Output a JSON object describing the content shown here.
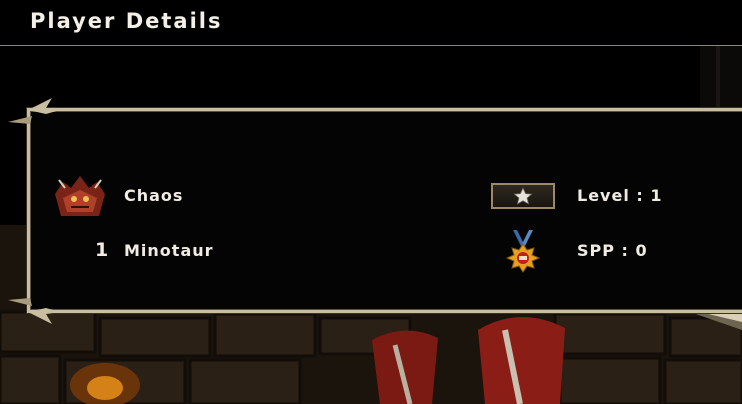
{
  "header": {
    "title": "Player Details"
  },
  "player": {
    "team": "Chaos",
    "number": "1",
    "position": "Minotaur",
    "level": "Level : 1",
    "spp": "SPP : 0"
  },
  "icons": {
    "team_logo": "chaos-team-logo-icon",
    "level_badge": "star-badge-icon",
    "spp_medal": "medal-icon"
  },
  "colors": {
    "frame": "#c9bfa0",
    "text": "#f0ece4",
    "background": "#000000"
  }
}
